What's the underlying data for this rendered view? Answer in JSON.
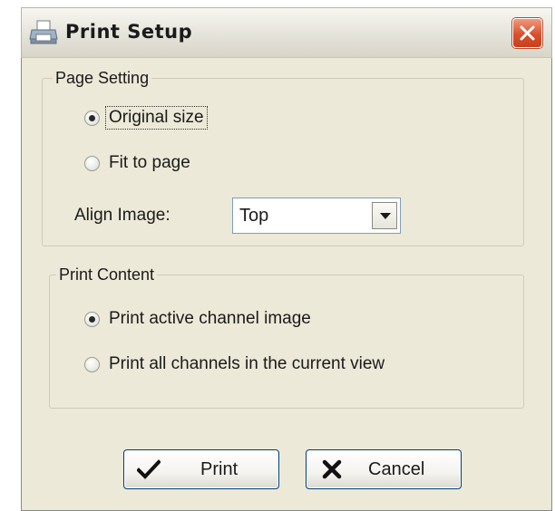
{
  "window": {
    "title": "Print Setup"
  },
  "page_setting": {
    "legend": "Page Setting",
    "options": [
      {
        "label": "Original size",
        "checked": true
      },
      {
        "label": "Fit to page",
        "checked": false
      }
    ],
    "align_label": "Align Image:",
    "align_value": "Top"
  },
  "print_content": {
    "legend": "Print Content",
    "options": [
      {
        "label": "Print active channel image",
        "checked": true
      },
      {
        "label": "Print all channels in the current view",
        "checked": false
      }
    ]
  },
  "buttons": {
    "print_label": "Print",
    "cancel_label": "Cancel"
  },
  "icons": {
    "title": "printer-icon",
    "close": "close-icon",
    "dropdown": "chevron-down-icon",
    "print": "checkmark-icon",
    "cancel": "x-mark-icon"
  },
  "colors": {
    "dialog_background": "#ece9d8",
    "close_button": "#d9502c",
    "button_border": "#003c74"
  }
}
